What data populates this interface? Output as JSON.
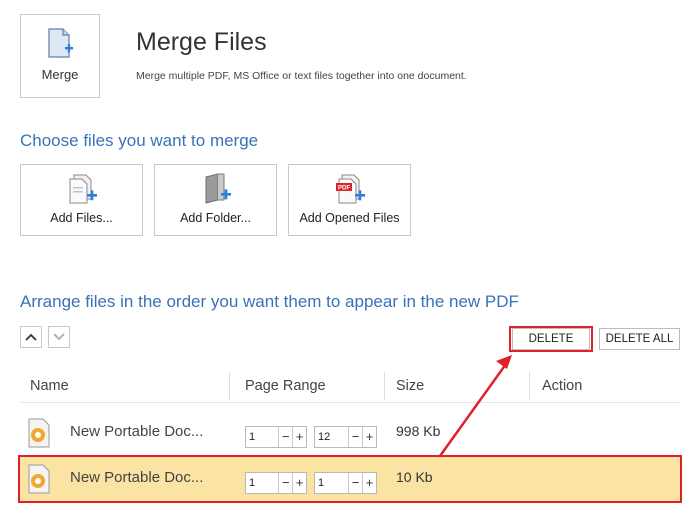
{
  "header": {
    "merge_tile_label": "Merge",
    "title": "Merge Files",
    "subtitle": "Merge multiple PDF, MS Office or text files together into one document."
  },
  "choose_section": {
    "heading": "Choose files you want to merge",
    "tiles": [
      {
        "label": "Add Files...",
        "icon": "add-files-icon"
      },
      {
        "label": "Add Folder...",
        "icon": "add-folder-icon"
      },
      {
        "label": "Add Opened Files",
        "icon": "add-opened-files-icon"
      }
    ]
  },
  "arrange_section": {
    "heading": "Arrange files in the order you want them to appear in the new PDF",
    "move_up_icon": "chevron-up-icon",
    "move_down_icon": "chevron-down-icon",
    "delete_label": "DELETE",
    "delete_all_label": "DELETE ALL"
  },
  "table": {
    "columns": [
      "Name",
      "Page Range",
      "Size",
      "Action"
    ],
    "rows": [
      {
        "name": "New Portable Doc...",
        "from": "1",
        "to": "12",
        "size": "998 Kb",
        "selected": false
      },
      {
        "name": "New Portable Doc...",
        "from": "1",
        "to": "1",
        "size": "10 Kb",
        "selected": true
      }
    ],
    "minus_glyph": "−",
    "plus_glyph": "+"
  },
  "colors": {
    "accent_blue": "#3a72b8",
    "highlight_red": "#e0202a",
    "selected_row": "#fbe3a4",
    "pdf_red": "#d9262c"
  }
}
